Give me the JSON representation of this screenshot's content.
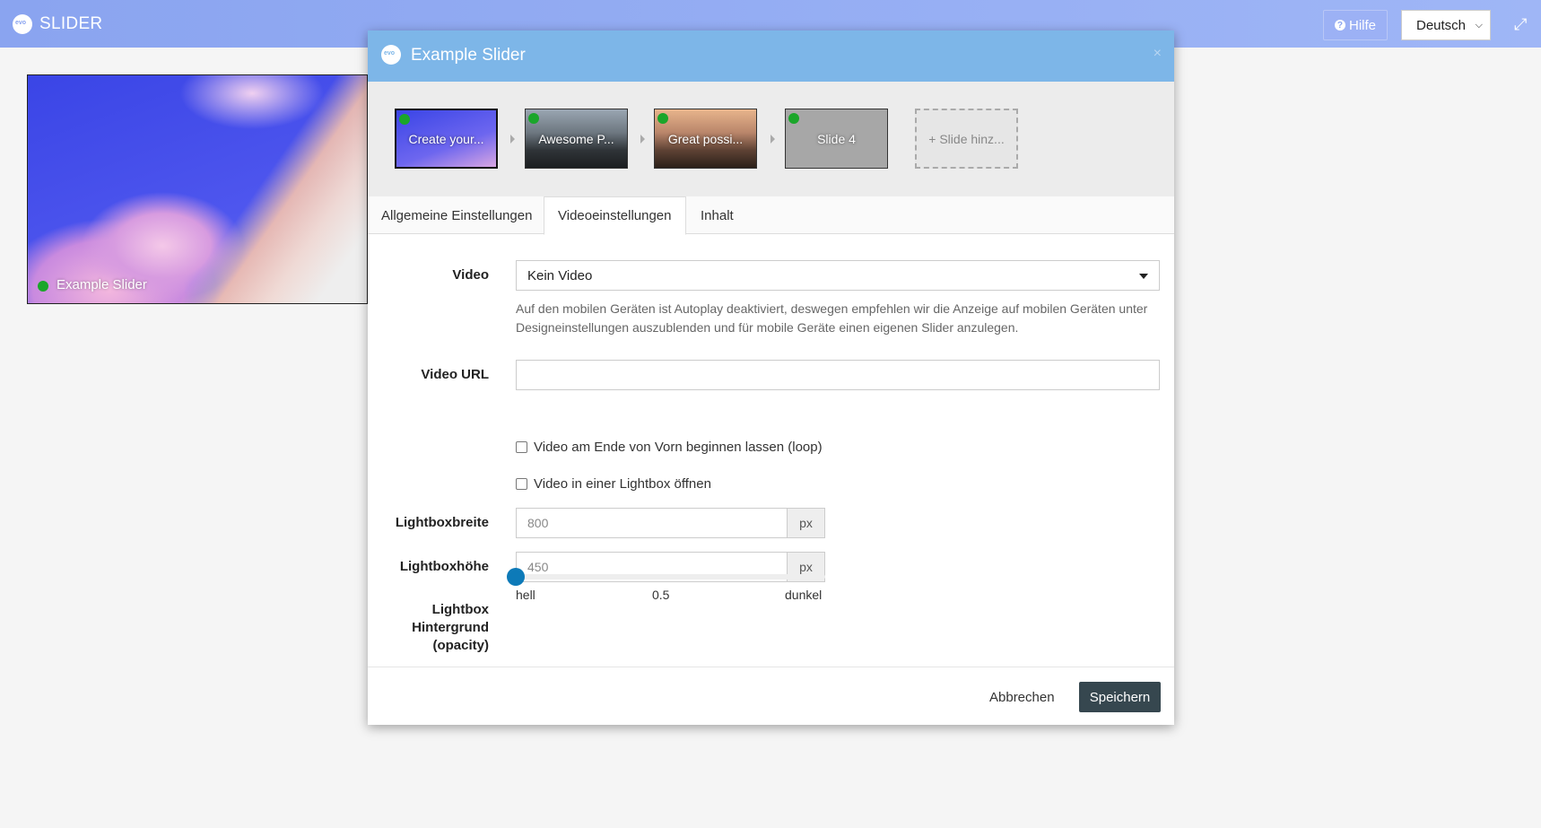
{
  "app": {
    "title": "SLIDER",
    "help_label": "Hilfe",
    "language": "Deutsch"
  },
  "preview": {
    "label": "Example Slider"
  },
  "modal": {
    "title": "Example Slider",
    "close": "×",
    "slides": [
      {
        "label": "Create your..."
      },
      {
        "label": "Awesome P..."
      },
      {
        "label": "Great possi..."
      },
      {
        "label": "Slide 4"
      }
    ],
    "add_slide": "+ Slide hinz...",
    "tabs": [
      {
        "label": "Allgemeine Einstellungen"
      },
      {
        "label": "Videoeinstellungen"
      },
      {
        "label": "Inhalt"
      }
    ],
    "video": {
      "label": "Video",
      "selected": "Kein Video",
      "help": "Auf den mobilen Geräten ist Autoplay deaktiviert, deswegen empfehlen wir die Anzeige auf mobilen Geräten unter Designeinstellungen auszublenden und für mobile Geräte einen eigenen Slider anzulegen."
    },
    "video_url": {
      "label": "Video URL",
      "value": ""
    },
    "loop_label": "Video am Ende von Vorn beginnen lassen (loop)",
    "lightbox_label": "Video in einer Lightbox öffnen",
    "lightbox_width": {
      "label": "Lightboxbreite",
      "placeholder": "800",
      "unit": "px"
    },
    "lightbox_height": {
      "label": "Lightboxhöhe",
      "placeholder": "450",
      "unit": "px"
    },
    "opacity": {
      "label_1": "Lightbox",
      "label_2": "Hintergrund",
      "label_3": "(opacity)",
      "value": 0,
      "min_label": "hell",
      "mid_label": "0.5",
      "max_label": "dunkel"
    },
    "cancel": "Abbrechen",
    "save": "Speichern"
  }
}
